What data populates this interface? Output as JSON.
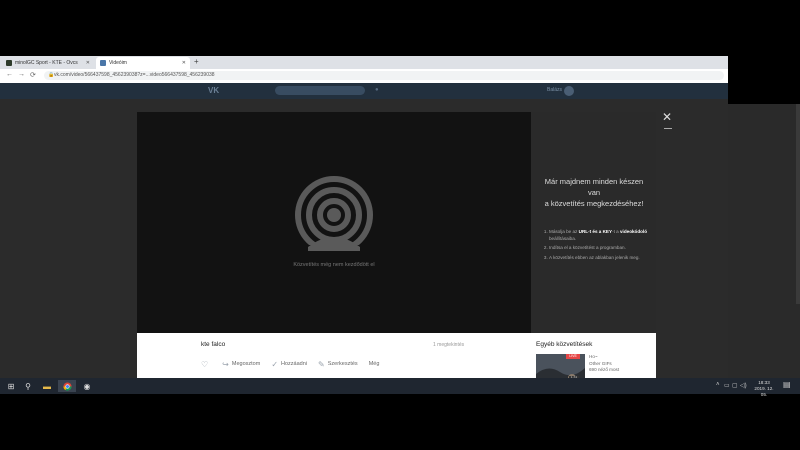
{
  "browser": {
    "tabs": [
      {
        "title": "minolGC Sport - KTE - Ovcs",
        "favicon_color": "#2d3a2a"
      },
      {
        "title": "Videóim",
        "favicon_color": "#4a76a8"
      }
    ],
    "new_tab": "+",
    "url": "vk.com/video/566437598_456239038?z=...video566437598_456239038",
    "nav": {
      "back": "←",
      "forward": "→",
      "reload": "⟳"
    }
  },
  "vk_header": {
    "logo": "VK",
    "user": "Balázs"
  },
  "modal": {
    "close": "✕",
    "player_status": "Közvetítés még nem kezdődött el",
    "side_title_lines": [
      "Már majdnem minden készen",
      "van",
      "a közvetítés megkezdéséhez!"
    ],
    "steps": [
      {
        "pre": "Másolja be az ",
        "bold1": "URL-t és a KEY",
        "mid": "-t a ",
        "bold2": "videokódoló",
        "post": " beállításaiba."
      },
      {
        "text": "Indítsa el a közvetítést a programban."
      },
      {
        "text": "A közvetítés ebben az ablakban jelenik meg."
      }
    ],
    "video_title": "kte falco",
    "views": "1 megtekintés",
    "actions": [
      {
        "icon": "heart-icon",
        "glyph": "♡",
        "label": ""
      },
      {
        "icon": "share-icon",
        "glyph": "↪",
        "label": "Megosztom"
      },
      {
        "icon": "check-icon",
        "glyph": "✓",
        "label": "Hozzáadni"
      },
      {
        "icon": "edit-icon",
        "glyph": "✎",
        "label": "Szerkesztés"
      },
      {
        "icon": "",
        "glyph": "",
        "label": "Még"
      }
    ],
    "other_title": "Egyéb közvetítések",
    "other_item": {
      "live": "LIVE",
      "badge": "1:21",
      "line1": "Ho~",
      "line2": "Other GIFs",
      "line3": "690 néző most"
    }
  },
  "taskbar": {
    "clock_time": "18:33",
    "clock_date": "2019. 12. 05."
  }
}
